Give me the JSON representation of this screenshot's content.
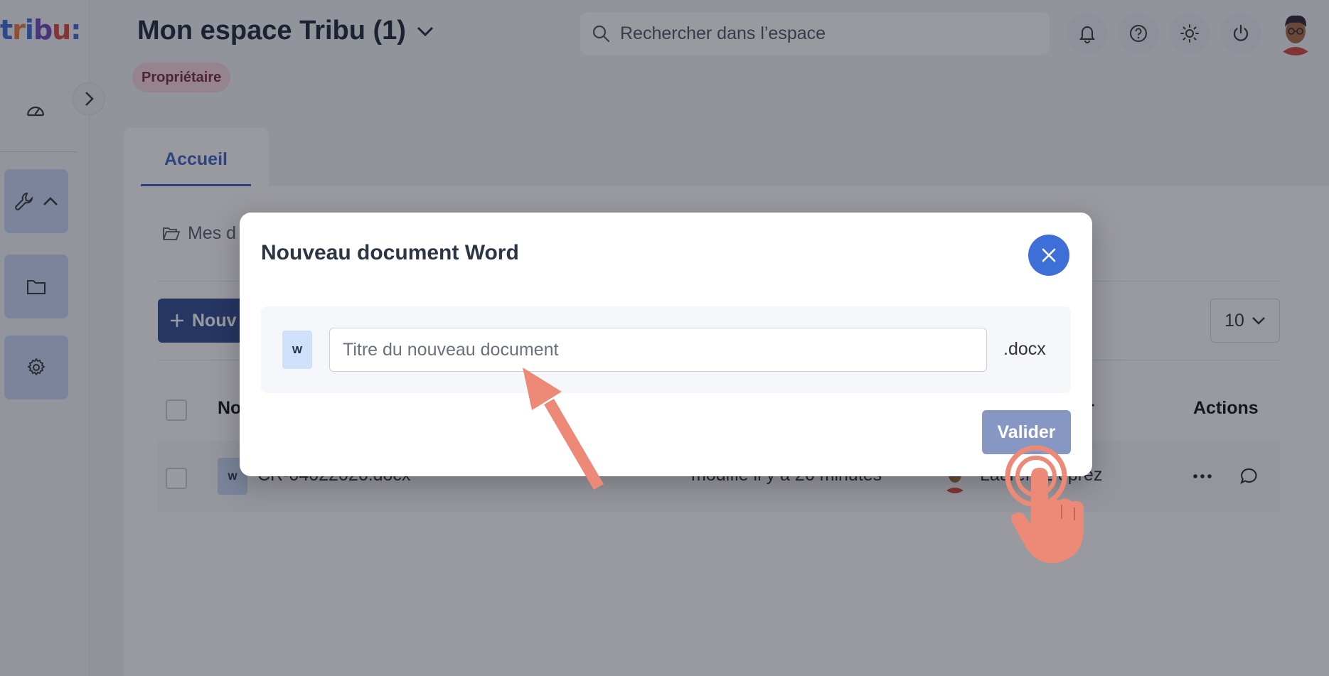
{
  "app": {
    "logo_text": "tribu:",
    "space_title": "Mon espace Tribu (1)",
    "role_badge": "Propriétaire",
    "search_placeholder": "Rechercher dans l’espace"
  },
  "tabs": [
    {
      "label": "Accueil",
      "active": true
    }
  ],
  "main": {
    "breadcrumb": "Mes d",
    "new_button": "Nouv",
    "per_page": "10",
    "columns": {
      "name": "No",
      "author": "eur",
      "actions": "Actions"
    },
    "rows": [
      {
        "icon_letter": "W",
        "name": "CR-04022026.docx",
        "modified": "modifié il y a 26 minutes",
        "author": "Laurent Deprez"
      }
    ]
  },
  "modal": {
    "title": "Nouveau document Word",
    "icon_letter": "W",
    "input_placeholder": "Titre du nouveau document",
    "extension": ".docx",
    "validate_label": "Valider"
  },
  "icons": {
    "sidebar": [
      "dashboard-icon",
      "wrench-icon",
      "chevron-up-icon",
      "folder-icon",
      "gear-icon"
    ],
    "header": [
      "bell-icon",
      "help-icon",
      "sun-icon",
      "power-icon"
    ],
    "modal": [
      "close-icon"
    ],
    "annotations": [
      "arrow-annotation",
      "tap-hand-annotation"
    ]
  },
  "colors": {
    "accent": "#3e6fd8",
    "primary_dark": "#2e4a8f",
    "badge_bg": "#f7d6dc",
    "annotation": "#ec8a77"
  }
}
